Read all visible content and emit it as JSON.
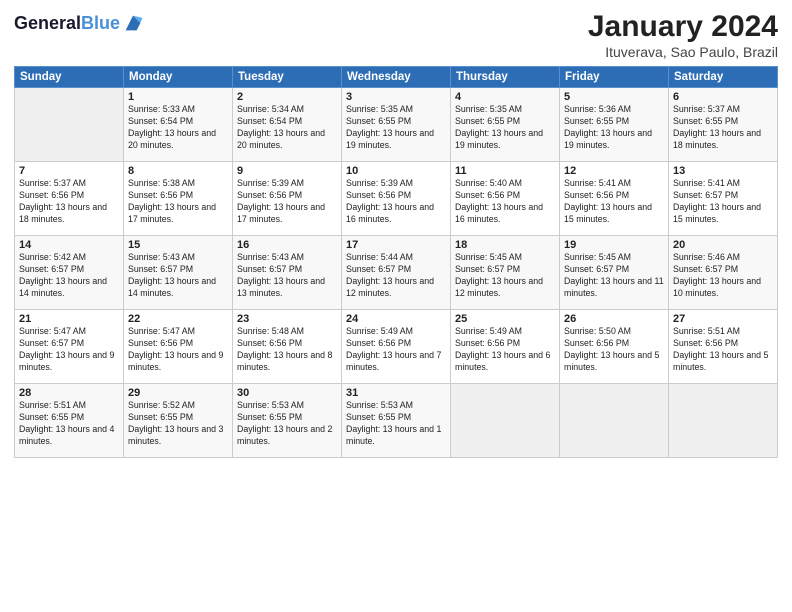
{
  "header": {
    "logo_line1": "General",
    "logo_line2": "Blue",
    "title": "January 2024",
    "location": "Ituverava, Sao Paulo, Brazil"
  },
  "days_of_week": [
    "Sunday",
    "Monday",
    "Tuesday",
    "Wednesday",
    "Thursday",
    "Friday",
    "Saturday"
  ],
  "weeks": [
    [
      {
        "day": "",
        "empty": true
      },
      {
        "day": "1",
        "sunrise": "Sunrise: 5:33 AM",
        "sunset": "Sunset: 6:54 PM",
        "daylight": "Daylight: 13 hours and 20 minutes."
      },
      {
        "day": "2",
        "sunrise": "Sunrise: 5:34 AM",
        "sunset": "Sunset: 6:54 PM",
        "daylight": "Daylight: 13 hours and 20 minutes."
      },
      {
        "day": "3",
        "sunrise": "Sunrise: 5:35 AM",
        "sunset": "Sunset: 6:55 PM",
        "daylight": "Daylight: 13 hours and 19 minutes."
      },
      {
        "day": "4",
        "sunrise": "Sunrise: 5:35 AM",
        "sunset": "Sunset: 6:55 PM",
        "daylight": "Daylight: 13 hours and 19 minutes."
      },
      {
        "day": "5",
        "sunrise": "Sunrise: 5:36 AM",
        "sunset": "Sunset: 6:55 PM",
        "daylight": "Daylight: 13 hours and 19 minutes."
      },
      {
        "day": "6",
        "sunrise": "Sunrise: 5:37 AM",
        "sunset": "Sunset: 6:55 PM",
        "daylight": "Daylight: 13 hours and 18 minutes."
      }
    ],
    [
      {
        "day": "7",
        "sunrise": "Sunrise: 5:37 AM",
        "sunset": "Sunset: 6:56 PM",
        "daylight": "Daylight: 13 hours and 18 minutes."
      },
      {
        "day": "8",
        "sunrise": "Sunrise: 5:38 AM",
        "sunset": "Sunset: 6:56 PM",
        "daylight": "Daylight: 13 hours and 17 minutes."
      },
      {
        "day": "9",
        "sunrise": "Sunrise: 5:39 AM",
        "sunset": "Sunset: 6:56 PM",
        "daylight": "Daylight: 13 hours and 17 minutes."
      },
      {
        "day": "10",
        "sunrise": "Sunrise: 5:39 AM",
        "sunset": "Sunset: 6:56 PM",
        "daylight": "Daylight: 13 hours and 16 minutes."
      },
      {
        "day": "11",
        "sunrise": "Sunrise: 5:40 AM",
        "sunset": "Sunset: 6:56 PM",
        "daylight": "Daylight: 13 hours and 16 minutes."
      },
      {
        "day": "12",
        "sunrise": "Sunrise: 5:41 AM",
        "sunset": "Sunset: 6:56 PM",
        "daylight": "Daylight: 13 hours and 15 minutes."
      },
      {
        "day": "13",
        "sunrise": "Sunrise: 5:41 AM",
        "sunset": "Sunset: 6:57 PM",
        "daylight": "Daylight: 13 hours and 15 minutes."
      }
    ],
    [
      {
        "day": "14",
        "sunrise": "Sunrise: 5:42 AM",
        "sunset": "Sunset: 6:57 PM",
        "daylight": "Daylight: 13 hours and 14 minutes."
      },
      {
        "day": "15",
        "sunrise": "Sunrise: 5:43 AM",
        "sunset": "Sunset: 6:57 PM",
        "daylight": "Daylight: 13 hours and 14 minutes."
      },
      {
        "day": "16",
        "sunrise": "Sunrise: 5:43 AM",
        "sunset": "Sunset: 6:57 PM",
        "daylight": "Daylight: 13 hours and 13 minutes."
      },
      {
        "day": "17",
        "sunrise": "Sunrise: 5:44 AM",
        "sunset": "Sunset: 6:57 PM",
        "daylight": "Daylight: 13 hours and 12 minutes."
      },
      {
        "day": "18",
        "sunrise": "Sunrise: 5:45 AM",
        "sunset": "Sunset: 6:57 PM",
        "daylight": "Daylight: 13 hours and 12 minutes."
      },
      {
        "day": "19",
        "sunrise": "Sunrise: 5:45 AM",
        "sunset": "Sunset: 6:57 PM",
        "daylight": "Daylight: 13 hours and 11 minutes."
      },
      {
        "day": "20",
        "sunrise": "Sunrise: 5:46 AM",
        "sunset": "Sunset: 6:57 PM",
        "daylight": "Daylight: 13 hours and 10 minutes."
      }
    ],
    [
      {
        "day": "21",
        "sunrise": "Sunrise: 5:47 AM",
        "sunset": "Sunset: 6:57 PM",
        "daylight": "Daylight: 13 hours and 9 minutes."
      },
      {
        "day": "22",
        "sunrise": "Sunrise: 5:47 AM",
        "sunset": "Sunset: 6:56 PM",
        "daylight": "Daylight: 13 hours and 9 minutes."
      },
      {
        "day": "23",
        "sunrise": "Sunrise: 5:48 AM",
        "sunset": "Sunset: 6:56 PM",
        "daylight": "Daylight: 13 hours and 8 minutes."
      },
      {
        "day": "24",
        "sunrise": "Sunrise: 5:49 AM",
        "sunset": "Sunset: 6:56 PM",
        "daylight": "Daylight: 13 hours and 7 minutes."
      },
      {
        "day": "25",
        "sunrise": "Sunrise: 5:49 AM",
        "sunset": "Sunset: 6:56 PM",
        "daylight": "Daylight: 13 hours and 6 minutes."
      },
      {
        "day": "26",
        "sunrise": "Sunrise: 5:50 AM",
        "sunset": "Sunset: 6:56 PM",
        "daylight": "Daylight: 13 hours and 5 minutes."
      },
      {
        "day": "27",
        "sunrise": "Sunrise: 5:51 AM",
        "sunset": "Sunset: 6:56 PM",
        "daylight": "Daylight: 13 hours and 5 minutes."
      }
    ],
    [
      {
        "day": "28",
        "sunrise": "Sunrise: 5:51 AM",
        "sunset": "Sunset: 6:55 PM",
        "daylight": "Daylight: 13 hours and 4 minutes."
      },
      {
        "day": "29",
        "sunrise": "Sunrise: 5:52 AM",
        "sunset": "Sunset: 6:55 PM",
        "daylight": "Daylight: 13 hours and 3 minutes."
      },
      {
        "day": "30",
        "sunrise": "Sunrise: 5:53 AM",
        "sunset": "Sunset: 6:55 PM",
        "daylight": "Daylight: 13 hours and 2 minutes."
      },
      {
        "day": "31",
        "sunrise": "Sunrise: 5:53 AM",
        "sunset": "Sunset: 6:55 PM",
        "daylight": "Daylight: 13 hours and 1 minute."
      },
      {
        "day": "",
        "empty": true
      },
      {
        "day": "",
        "empty": true
      },
      {
        "day": "",
        "empty": true
      }
    ]
  ]
}
